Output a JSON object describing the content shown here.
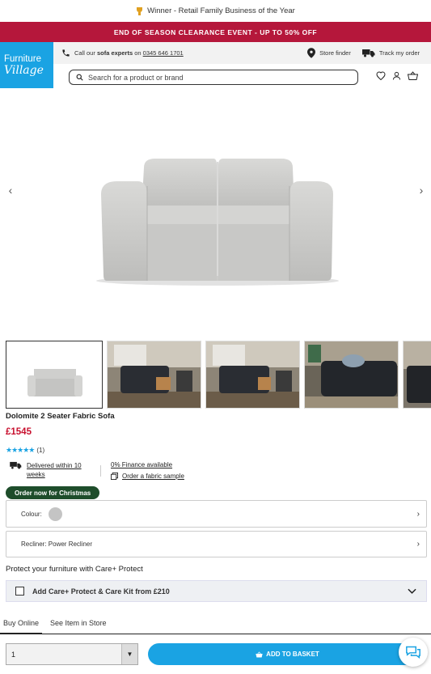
{
  "banner": {
    "text": "Winner - Retail Family Business of the Year"
  },
  "promo": {
    "text": "END OF SEASON CLEARANCE EVENT - UP TO 50% OFF"
  },
  "logo": {
    "line1": "Furniture",
    "line2": "Village"
  },
  "infobar": {
    "call_prefix": "Call our",
    "call_bold": "sofa experts",
    "call_mid": "on",
    "phone": "0345 646 1701",
    "store_finder": "Store finder",
    "track_order": "Track my order"
  },
  "search": {
    "placeholder": "Search for a product or brand"
  },
  "product": {
    "name": "Dolomite 2 Seater Fabric Sofa",
    "price": "£1545",
    "stars": "★★★★★",
    "review_count": "(1)",
    "rating": 5,
    "delivery": "Delivered within 10 weeks",
    "finance": "0% Finance available",
    "sample": "Order a fabric sample",
    "badge": "Order now for Christmas"
  },
  "options": {
    "colour_label": "Colour:",
    "colour_swatch": "#c4c4c4",
    "recliner_label": "Recliner: Power Recliner"
  },
  "protect": {
    "heading": "Protect your furniture with Care+ Protect",
    "checkbox_label": "Add Care+ Protect & Care Kit from £210"
  },
  "tabs": [
    "Buy Online",
    "See Item in Store"
  ],
  "purchase": {
    "quantity": "1",
    "basket_label": "ADD TO BASKET"
  },
  "colors": {
    "brand_blue": "#1aa3e3",
    "promo_red": "#b5173b",
    "price_red": "#c8102e",
    "badge_green": "#1e4d2b"
  }
}
